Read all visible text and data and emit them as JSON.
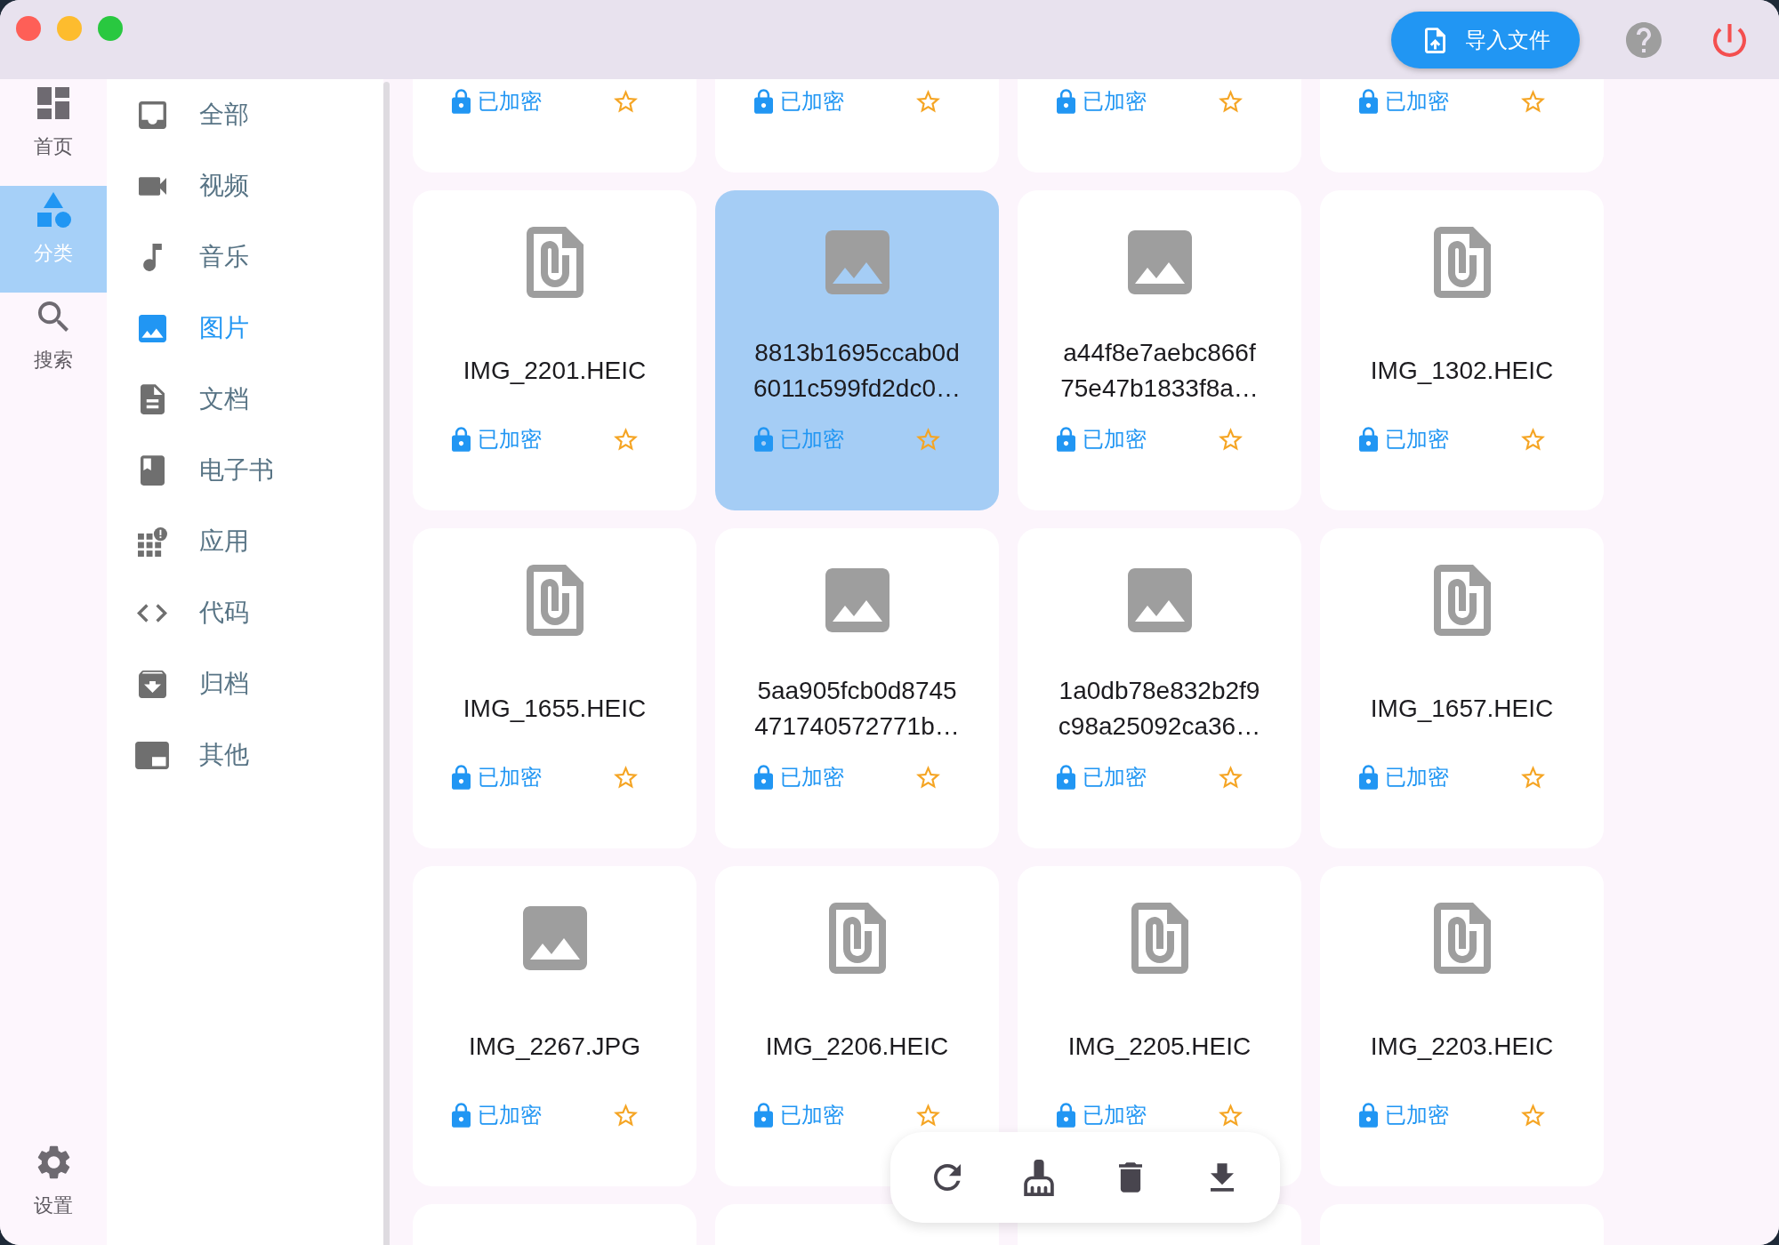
{
  "title_bar": {
    "import_button": "导入文件"
  },
  "nav_rail": {
    "items": [
      {
        "label": "首页",
        "selected": false
      },
      {
        "label": "分类",
        "selected": true
      },
      {
        "label": "搜索",
        "selected": false
      }
    ],
    "settings": {
      "label": "设置",
      "selected": false
    }
  },
  "categories": [
    {
      "label": "全部",
      "selected": false
    },
    {
      "label": "视频",
      "selected": false
    },
    {
      "label": "音乐",
      "selected": false
    },
    {
      "label": "图片",
      "selected": true
    },
    {
      "label": "文档",
      "selected": false
    },
    {
      "label": "电子书",
      "selected": false
    },
    {
      "label": "应用",
      "selected": false
    },
    {
      "label": "代码",
      "selected": false
    },
    {
      "label": "归档",
      "selected": false
    },
    {
      "label": "其他",
      "selected": false
    }
  ],
  "file_grid": {
    "rows": [
      {
        "kind": "cut_top",
        "cards": [
          {
            "badge": "已加密",
            "starred": false,
            "selected": false
          },
          {
            "badge": "已加密",
            "starred": false,
            "selected": false
          },
          {
            "badge": "已加密",
            "starred": false,
            "selected": false
          },
          {
            "badge": "已加密",
            "starred": false,
            "selected": false
          }
        ]
      },
      {
        "kind": "full",
        "cards": [
          {
            "kind": "file",
            "name": "IMG_2201.HEIC",
            "badge": "已加密",
            "starred": false,
            "selected": false
          },
          {
            "kind": "image",
            "name": "8813b1695ccab0d\n6011c599fd2dc0…",
            "badge": "已加密",
            "starred": false,
            "selected": true
          },
          {
            "kind": "image",
            "name": "a44f8e7aebc866f\n75e47b1833f8a…",
            "badge": "已加密",
            "starred": false,
            "selected": false
          },
          {
            "kind": "file",
            "name": "IMG_1302.HEIC",
            "badge": "已加密",
            "starred": false,
            "selected": false
          }
        ]
      },
      {
        "kind": "full",
        "cards": [
          {
            "kind": "file",
            "name": "IMG_1655.HEIC",
            "badge": "已加密",
            "starred": false,
            "selected": false
          },
          {
            "kind": "image",
            "name": "5aa905fcb0d8745\n471740572771b…",
            "badge": "已加密",
            "starred": false,
            "selected": false
          },
          {
            "kind": "image",
            "name": "1a0db78e832b2f9\nc98a25092ca36…",
            "badge": "已加密",
            "starred": false,
            "selected": false
          },
          {
            "kind": "file",
            "name": "IMG_1657.HEIC",
            "badge": "已加密",
            "starred": false,
            "selected": false
          }
        ]
      },
      {
        "kind": "full",
        "cards": [
          {
            "kind": "image",
            "name": "IMG_2267.JPG",
            "badge": "已加密",
            "starred": false,
            "selected": false
          },
          {
            "kind": "file",
            "name": "IMG_2206.HEIC",
            "badge": "已加密",
            "starred": false,
            "selected": false
          },
          {
            "kind": "file",
            "name": "IMG_2205.HEIC",
            "badge": "已加密",
            "starred": false,
            "selected": false
          },
          {
            "kind": "file",
            "name": "IMG_2203.HEIC",
            "badge": "已加密",
            "starred": false,
            "selected": false
          }
        ]
      },
      {
        "kind": "cut_bottom",
        "cards": [
          {
            "selected": false
          },
          {
            "selected": false
          },
          {
            "selected": false
          },
          {
            "selected": false
          }
        ]
      }
    ]
  }
}
